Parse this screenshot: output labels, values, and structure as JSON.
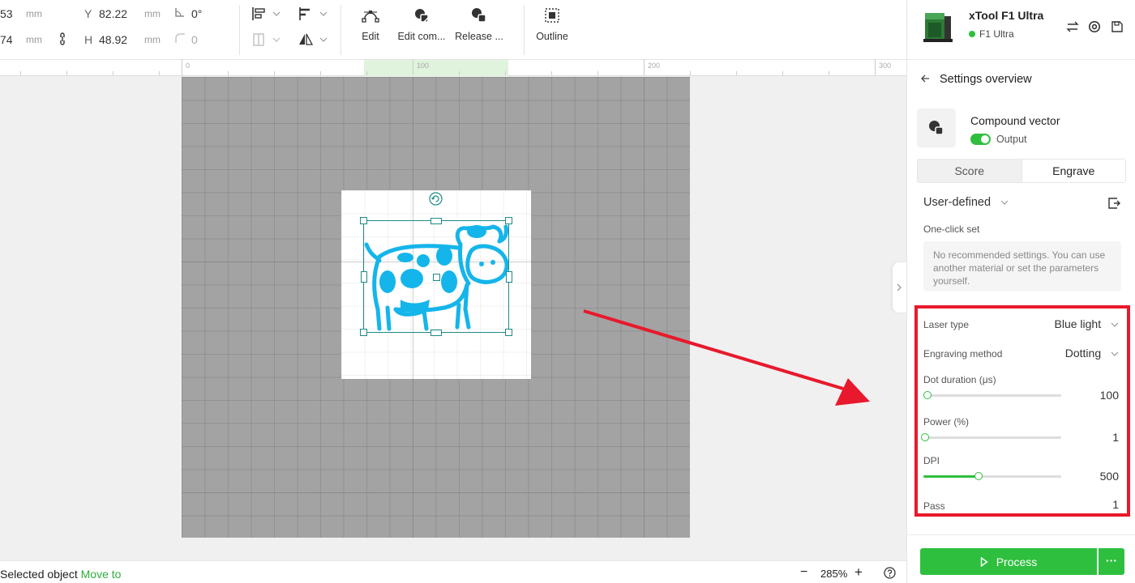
{
  "toolbar": {
    "x_value": "53",
    "x_unit": "mm",
    "y_label": "Y",
    "y_value": "82.22",
    "y_unit": "mm",
    "angle_value": "0°",
    "w_value": "74",
    "w_unit": "mm",
    "h_label": "H",
    "h_value": "48.92",
    "h_unit": "mm",
    "corner_value": "0",
    "edit_label": "Edit",
    "edit_compound_label": "Edit com...",
    "release_label": "Release ...",
    "outline_label": "Outline"
  },
  "ruler": {
    "ticks": [
      "0",
      "100",
      "200",
      "300"
    ]
  },
  "status": {
    "selected_label": "Selected object",
    "move_to_label": "Move to",
    "zoom": "285%",
    "zoom_out": "−",
    "zoom_in": "+"
  },
  "device": {
    "name": "xTool F1 Ultra",
    "model": "F1 Ultra",
    "status_color": "#2fbf3f"
  },
  "panel": {
    "back_title": "Settings overview",
    "object_name": "Compound vector",
    "output_label": "Output",
    "tabs": [
      {
        "label": "Score"
      },
      {
        "label": "Engrave"
      }
    ],
    "active_tab": "Engrave",
    "preset": "User-defined",
    "oneclick_label": "One-click set",
    "oneclick_message": "No recommended settings. You can use another material or set the parameters yourself.",
    "params": {
      "laser_type_label": "Laser type",
      "laser_type_value": "Blue light",
      "method_label": "Engraving method",
      "method_value": "Dotting",
      "dot_duration_label": "Dot duration (μs)",
      "dot_duration_value": "100",
      "dot_duration_level": 0.03,
      "power_label": "Power (%)",
      "power_value": "1",
      "power_level": 0.01,
      "dpi_label": "DPI",
      "dpi_value": "500",
      "dpi_level": 0.4,
      "pass_label": "Pass",
      "pass_value": "1"
    },
    "process_label": "Process",
    "more_label": "···"
  },
  "colors": {
    "accent": "#2fbf3f",
    "highlight": "#e8192c",
    "artwork": "#14b5ea",
    "selection": "#1e8a86"
  }
}
